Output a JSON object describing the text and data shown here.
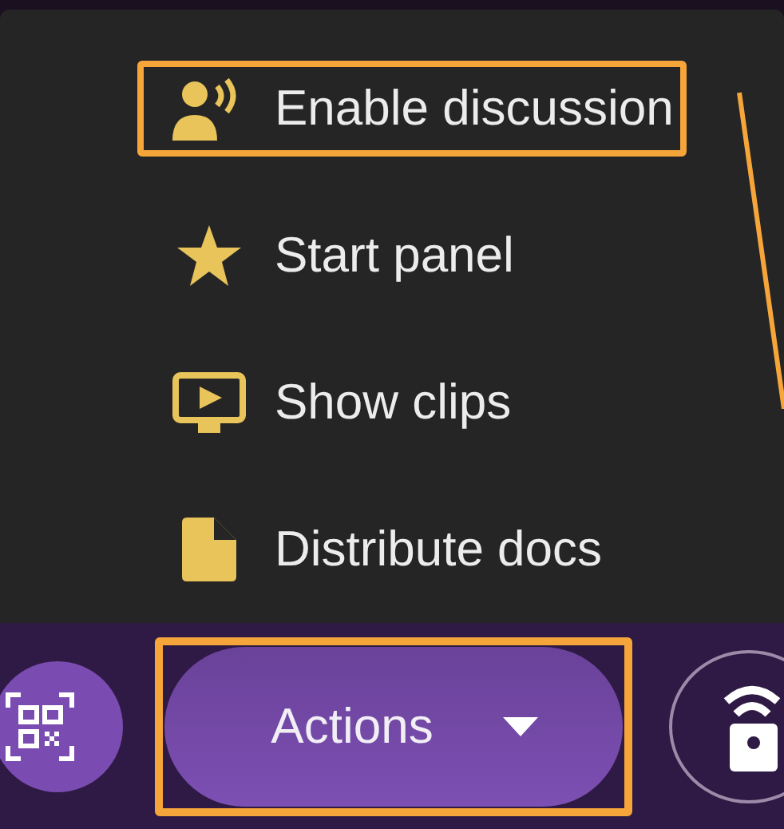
{
  "menu": {
    "items": [
      {
        "label": "Enable discussion",
        "highlighted": true
      },
      {
        "label": "Start panel",
        "highlighted": false
      },
      {
        "label": "Show clips",
        "highlighted": false
      },
      {
        "label": "Distribute docs",
        "highlighted": false
      }
    ]
  },
  "actions_button": {
    "label": "Actions",
    "highlighted": true
  }
}
